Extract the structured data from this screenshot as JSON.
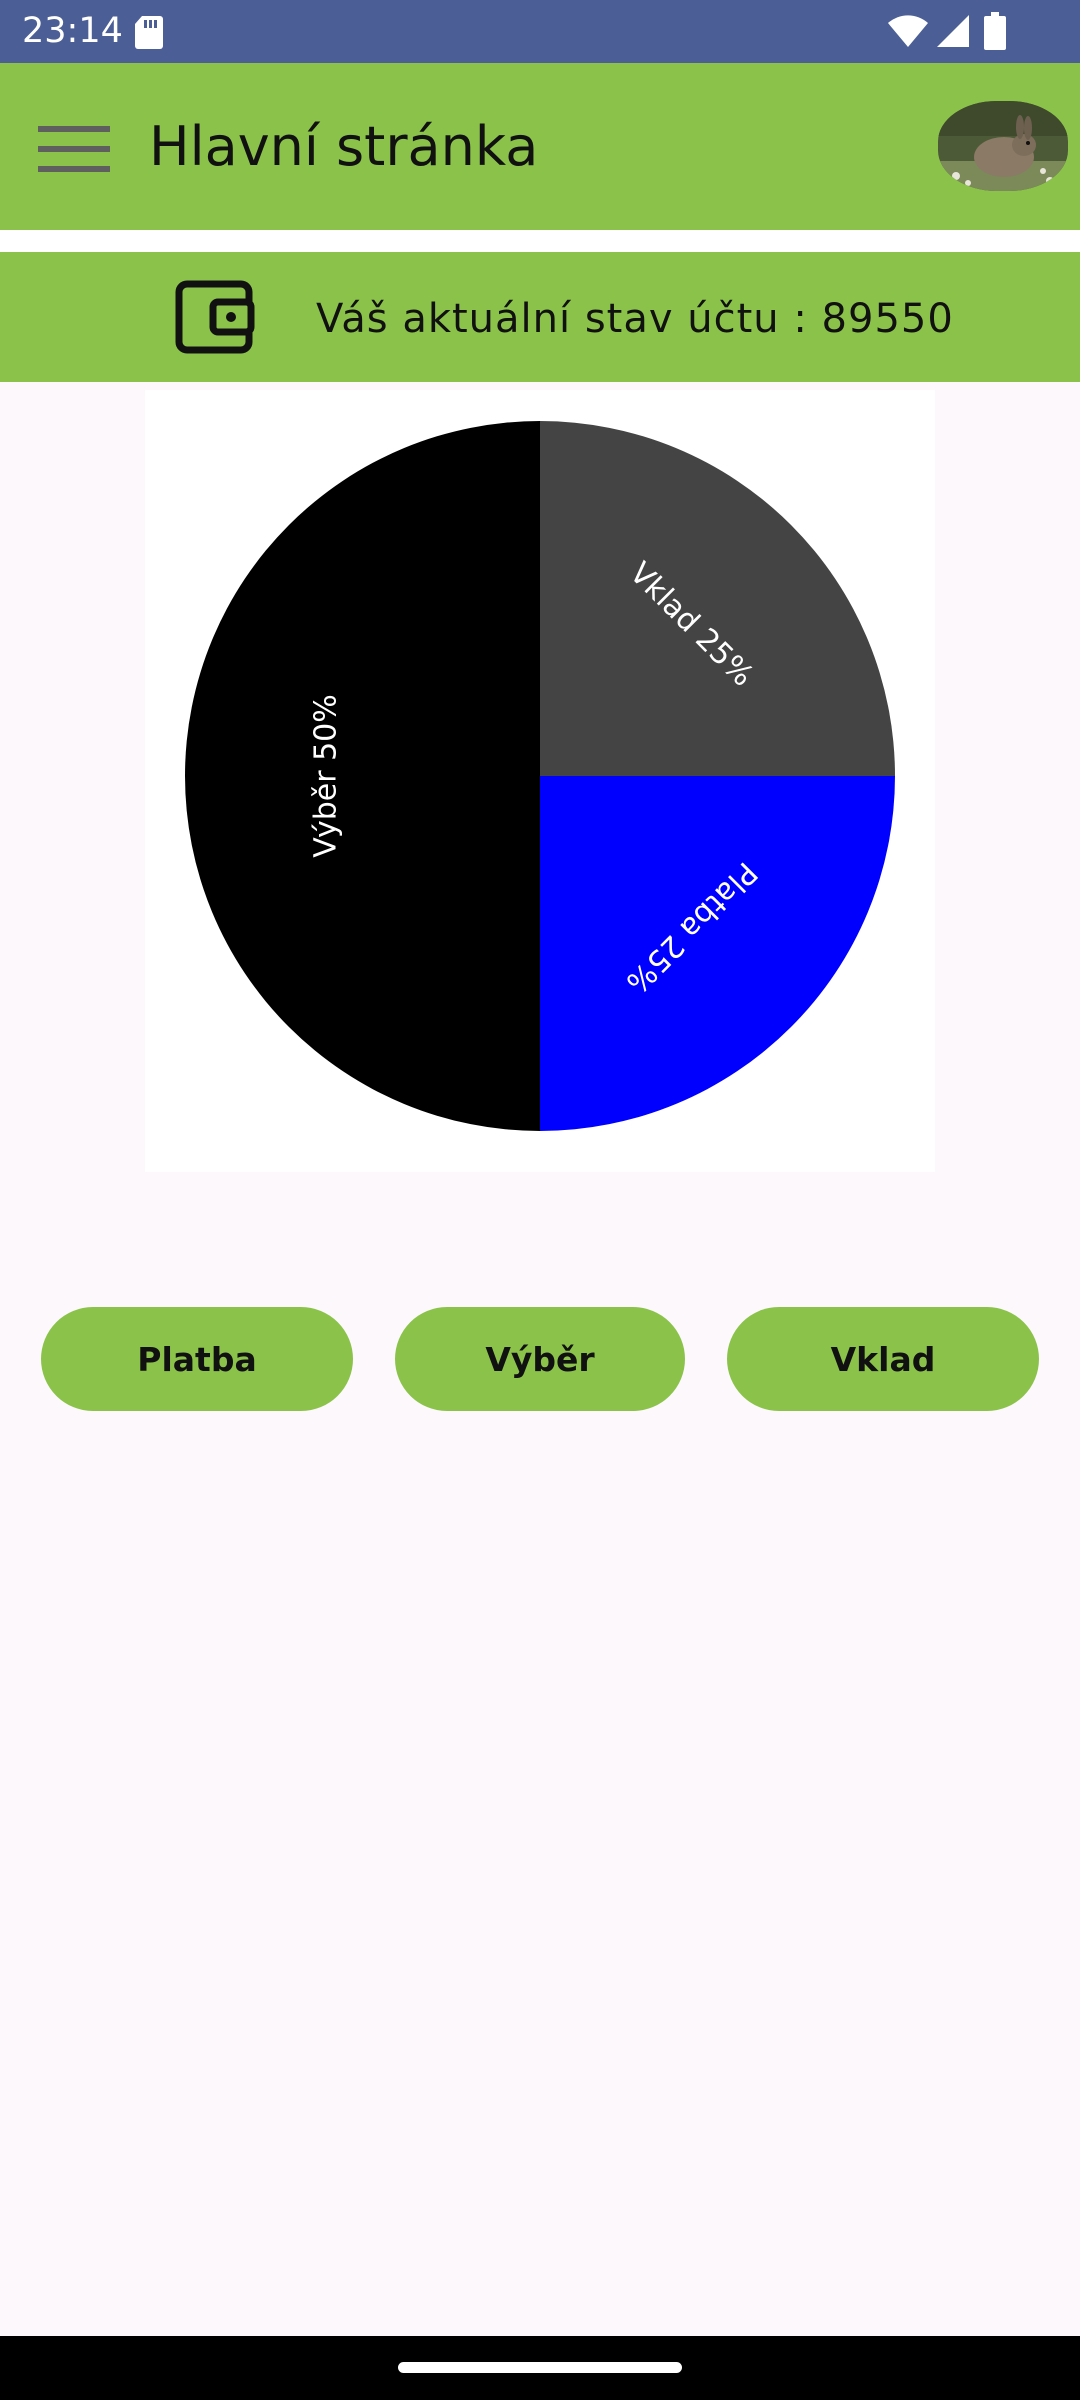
{
  "status_bar": {
    "time": "23:14",
    "icons": [
      "sd-card-icon",
      "wifi-icon",
      "signal-icon",
      "battery-icon"
    ]
  },
  "app_bar": {
    "title": "Hlavní stránka",
    "menu_icon": "menu-icon",
    "avatar": "rabbit-avatar"
  },
  "balance": {
    "icon": "wallet-icon",
    "text": "Váš aktuální stav účtu : 89550"
  },
  "chart_data": {
    "type": "pie",
    "slices": [
      {
        "label": "Vklad 25%",
        "value": 25,
        "color": "#444444"
      },
      {
        "label": "Platba 25%",
        "value": 25,
        "color": "#0000ff"
      },
      {
        "label": "Výběr 50%",
        "value": 50,
        "color": "#000000"
      }
    ],
    "start_angle_deg": 0,
    "direction": "clockwise",
    "label_color": "#ffffff"
  },
  "actions": {
    "platba_label": "Platba",
    "vyber_label": "Výběr",
    "vklad_label": "Vklad"
  },
  "colors": {
    "status_bar": "#4b5e95",
    "app_bar": "#8bc34a",
    "background": "#fcf8fc",
    "button": "#8bc34a"
  }
}
